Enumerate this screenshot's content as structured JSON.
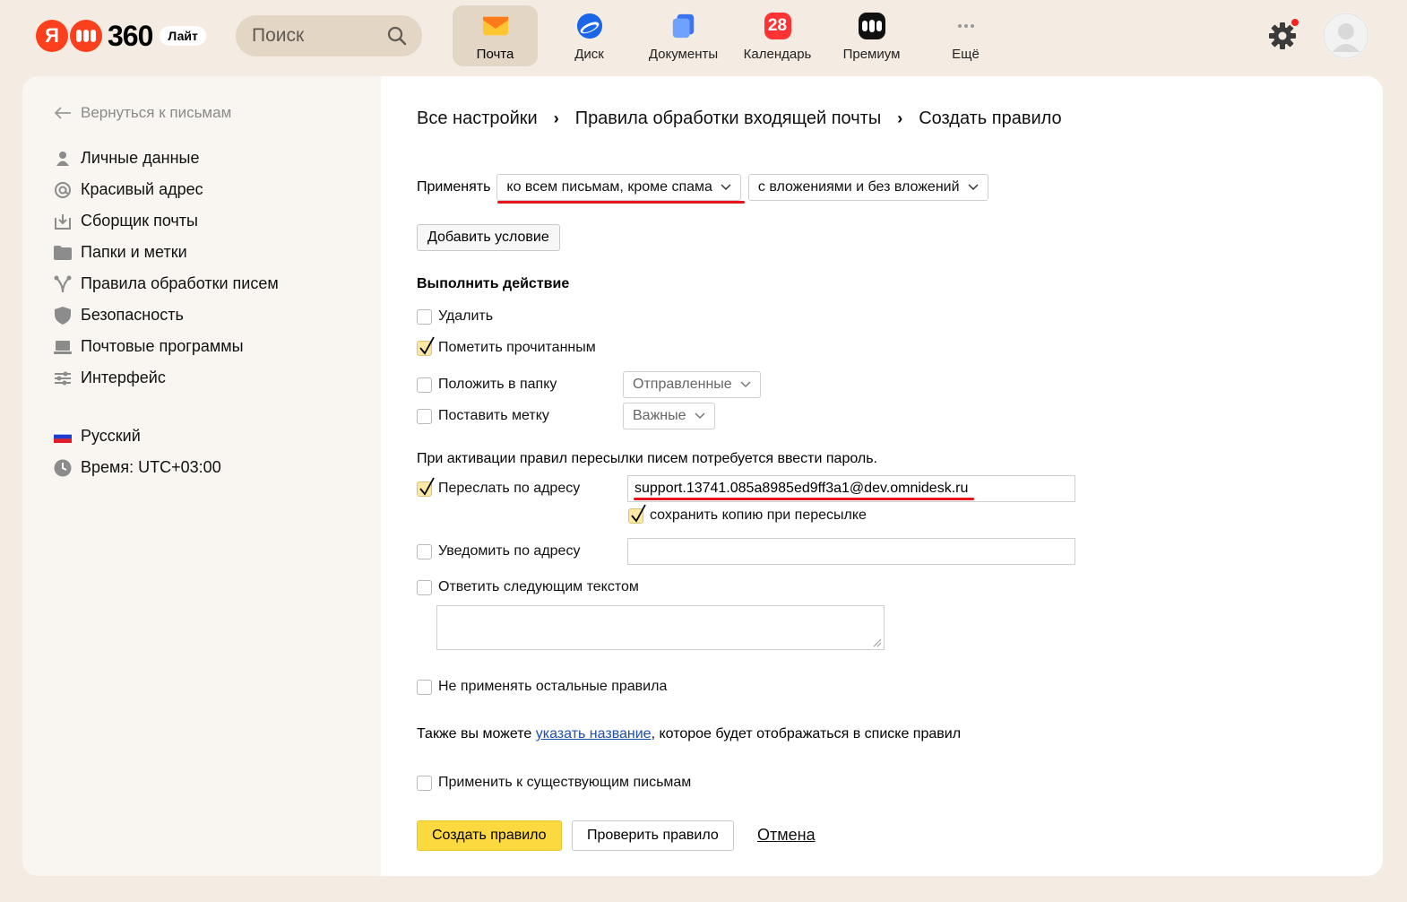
{
  "header": {
    "logo_text": "360",
    "logo_badge": "Лайт",
    "search_placeholder": "Поиск",
    "services": [
      {
        "label": "Почта",
        "icon": "mail-icon",
        "active": true
      },
      {
        "label": "Диск",
        "icon": "disk-icon"
      },
      {
        "label": "Документы",
        "icon": "documents-icon"
      },
      {
        "label": "Календарь",
        "icon": "calendar-icon",
        "day": "28"
      },
      {
        "label": "Премиум",
        "icon": "premium-icon"
      },
      {
        "label": "Ещё",
        "icon": "more-icon"
      }
    ],
    "notification_color": "#ff1f1f"
  },
  "sidebar": {
    "back_label": "Вернуться к письмам",
    "items": [
      {
        "label": "Личные данные",
        "icon": "person-icon"
      },
      {
        "label": "Красивый адрес",
        "icon": "at-icon"
      },
      {
        "label": "Сборщик почты",
        "icon": "inbox-download-icon"
      },
      {
        "label": "Папки и метки",
        "icon": "folder-icon"
      },
      {
        "label": "Правила обработки писем",
        "icon": "filter-rules-icon"
      },
      {
        "label": "Безопасность",
        "icon": "shield-icon"
      },
      {
        "label": "Почтовые программы",
        "icon": "laptop-icon"
      },
      {
        "label": "Интерфейс",
        "icon": "sliders-icon"
      }
    ],
    "language": "Русский",
    "time": "Время: UTC+03:00"
  },
  "breadcrumbs": [
    "Все настройки",
    "Правила обработки входящей почты",
    "Создать правило"
  ],
  "form": {
    "apply_label": "Применять",
    "apply_scope": "ко всем письмам, кроме спама",
    "apply_attachments": "с вложениями и без вложений",
    "add_condition": "Добавить условие",
    "action_title": "Выполнить действие",
    "actions": {
      "delete": {
        "label": "Удалить",
        "checked": false
      },
      "mark_read": {
        "label": "Пометить прочитанным",
        "checked": true
      },
      "move_folder": {
        "label": "Положить в папку",
        "checked": false,
        "folder": "Отправленные"
      },
      "set_label": {
        "label": "Поставить метку",
        "checked": false,
        "value": "Важные"
      }
    },
    "forward_note": "При активации правил пересылки писем потребуется ввести пароль.",
    "forward": {
      "label": "Переслать по адресу",
      "checked": true,
      "address": "support.13741.085a8985ed9ff3a1@dev.omnidesk.ru"
    },
    "keep_copy": {
      "label": "сохранить копию при пересылке",
      "checked": true
    },
    "notify": {
      "label": "Уведомить по адресу",
      "checked": false,
      "address": ""
    },
    "reply": {
      "label": "Ответить следующим текстом",
      "checked": false,
      "text": ""
    },
    "no_other_rules": {
      "label": "Не применять остальные правила",
      "checked": false
    },
    "name_hint_before": "Также вы можете ",
    "name_hint_link": "указать название",
    "name_hint_after": ", которое будет отображаться в списке правил",
    "apply_existing": {
      "label": "Применить к существующим письмам",
      "checked": false
    },
    "create_button": "Создать правило",
    "check_button": "Проверить правило",
    "cancel_link": "Отмена"
  },
  "colors": {
    "background": "#f4ece2",
    "primary_button": "#fcd93e",
    "highlight_underline": "#e8131d",
    "link": "#1f4fae"
  }
}
